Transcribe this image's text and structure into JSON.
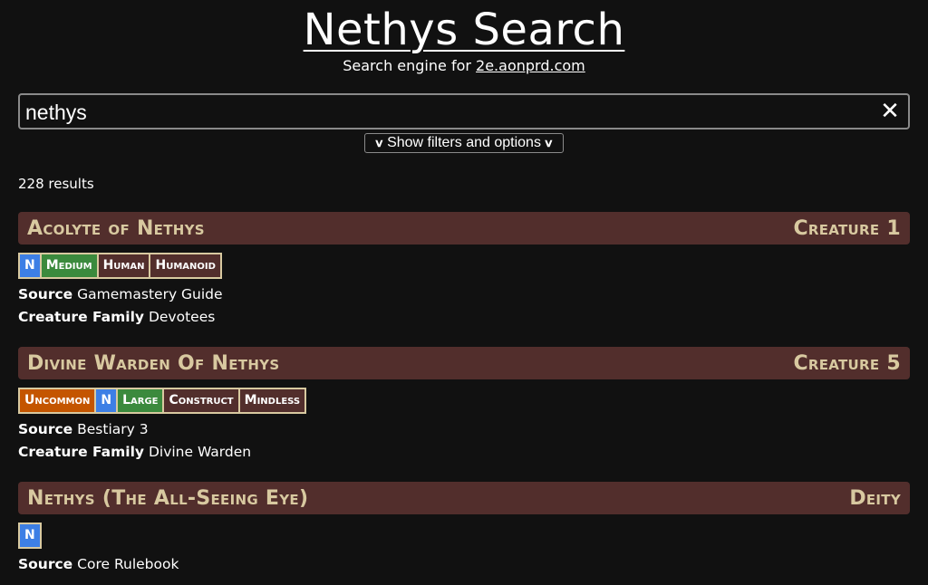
{
  "header": {
    "title": "Nethys Search",
    "subtitle_prefix": "Search engine for ",
    "subtitle_link": "2e.aonprd.com"
  },
  "search": {
    "value": "nethys",
    "clear_icon": "close-icon"
  },
  "filters_button": {
    "label": "Show filters and options",
    "icon": "chevron-down-icon"
  },
  "results_count": "228 results",
  "colors": {
    "header_bg": "#522e2c",
    "header_text": "#d8c9a0",
    "trait_border": "#d8c9a0",
    "alignment": "#3d7fe5",
    "size": "#3b8a3d",
    "rarity": "#c45500",
    "trait_default": "#522e2c"
  },
  "results": [
    {
      "title": "Acolyte of Nethys",
      "type": "Creature 1",
      "traits": [
        {
          "label": "N",
          "kind": "align"
        },
        {
          "label": "Medium",
          "kind": "size"
        },
        {
          "label": "Human",
          "kind": "plain"
        },
        {
          "label": "Humanoid",
          "kind": "plain"
        }
      ],
      "fields": [
        {
          "label": "Source",
          "value": "Gamemastery Guide"
        },
        {
          "label": "Creature Family",
          "value": "Devotees"
        }
      ]
    },
    {
      "title": "Divine Warden Of Nethys",
      "type": "Creature 5",
      "traits": [
        {
          "label": "Uncommon",
          "kind": "rarity"
        },
        {
          "label": "N",
          "kind": "align"
        },
        {
          "label": "Large",
          "kind": "size"
        },
        {
          "label": "Construct",
          "kind": "plain"
        },
        {
          "label": "Mindless",
          "kind": "plain"
        }
      ],
      "fields": [
        {
          "label": "Source",
          "value": "Bestiary 3"
        },
        {
          "label": "Creature Family",
          "value": "Divine Warden"
        }
      ]
    },
    {
      "title": "Nethys (The All-Seeing Eye)",
      "type": "Deity",
      "traits": [
        {
          "label": "N",
          "kind": "align"
        }
      ],
      "fields": [
        {
          "label": "Source",
          "value": "Core Rulebook"
        }
      ]
    }
  ]
}
